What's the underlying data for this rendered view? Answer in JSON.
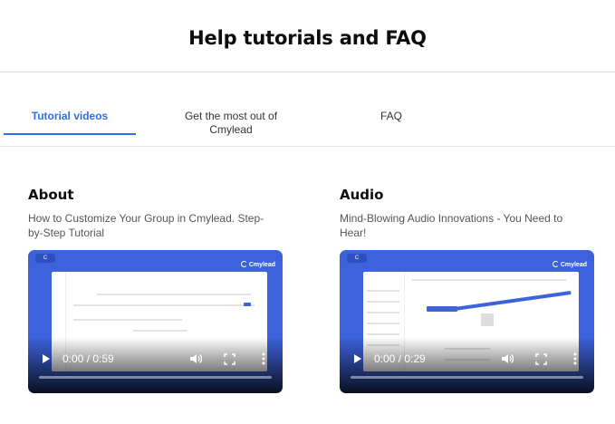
{
  "header": {
    "title": "Help tutorials and FAQ"
  },
  "tabs": [
    {
      "label": "Tutorial videos",
      "active": true
    },
    {
      "label": "Get the most out of Cmylead",
      "active": false
    },
    {
      "label": "FAQ",
      "active": false
    }
  ],
  "cards": [
    {
      "title": "About",
      "description": "How to Customize Your Group in Cmylead. Step-by-Step Tutorial",
      "video": {
        "time": "0:00 / 0:59",
        "brand": "Cmylead",
        "progress": 0
      }
    },
    {
      "title": "Audio",
      "description": "Mind-Blowing Audio Innovations - You Need to Hear!",
      "video": {
        "time": "0:00 / 0:29",
        "brand": "Cmylead",
        "progress": 0
      }
    }
  ],
  "colors": {
    "accent": "#2f6fde",
    "video_bg": "#3d63dc"
  },
  "icons": {
    "play": "play-icon",
    "volume": "volume-icon",
    "fullscreen": "fullscreen-icon",
    "more": "more-vertical-icon"
  }
}
